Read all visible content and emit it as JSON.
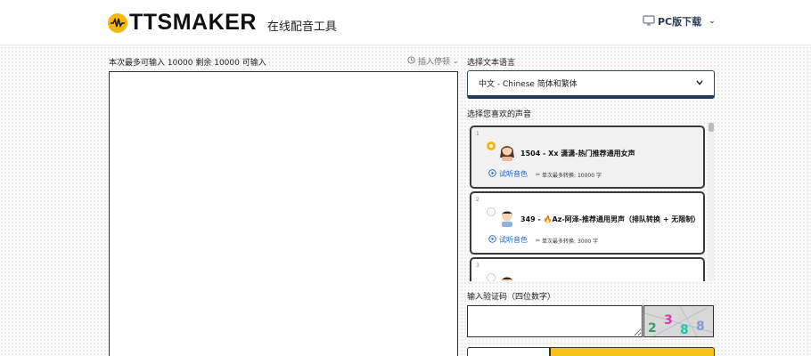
{
  "header": {
    "logo_text": "TTSMAKER",
    "logo_subtitle": "在线配音工具",
    "pc_download_label": "PC版下载"
  },
  "editor": {
    "limit_text": "本次最多可输入 10000 剩余 10000 可输入",
    "insert_pause_label": "插入停顿",
    "text_value": ""
  },
  "language": {
    "label": "选择文本语言",
    "selected": "中文 - Chinese 简体和繁体"
  },
  "voices": {
    "label": "选择您喜欢的声音",
    "listen_label": "试听音色",
    "items": [
      {
        "index": "1",
        "name": "1504 - Xx 潇潇-热门推荐通用女声",
        "limit": "单次最多转换: 10000 字",
        "selected": true
      },
      {
        "index": "2",
        "name": "349 - 🔥Az-阿泽-推荐通用男声（排队转换 + 无限制）",
        "limit": "单次最多转换: 3000 字",
        "selected": false
      },
      {
        "index": "3",
        "name": "",
        "limit": "",
        "selected": false
      }
    ]
  },
  "captcha": {
    "label": "输入验证码（四位数字）",
    "value": "",
    "image_text": "2 3 8 8"
  },
  "colors": {
    "accent": "#f5b70a",
    "link": "#1a63c9",
    "select_border": "#213a5a"
  }
}
